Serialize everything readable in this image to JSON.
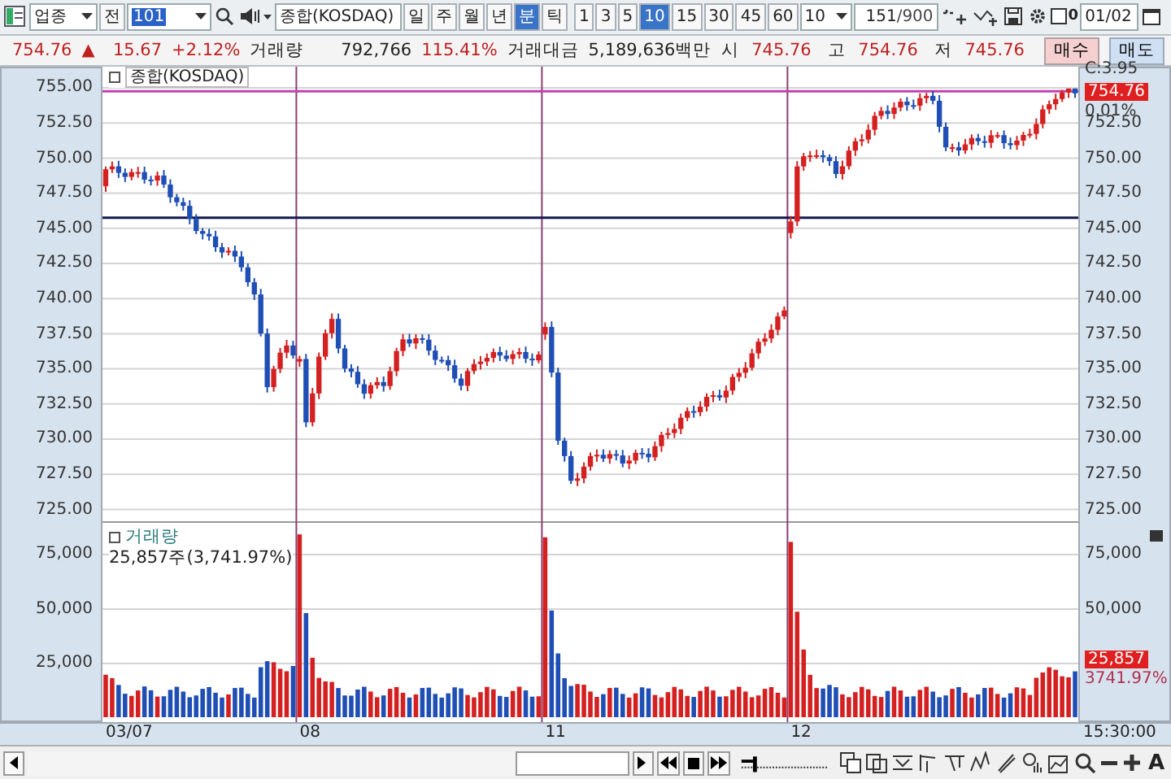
{
  "toolbar": {
    "market_select": "업종",
    "prev_button": "전",
    "code_field": "101",
    "name_field": "종합(KOSDAQ)",
    "periods": [
      {
        "label": "일",
        "selected": false
      },
      {
        "label": "주",
        "selected": false
      },
      {
        "label": "월",
        "selected": false
      },
      {
        "label": "년",
        "selected": false
      },
      {
        "label": "분",
        "selected": true
      },
      {
        "label": "틱",
        "selected": false
      }
    ],
    "intervals": [
      {
        "label": "1",
        "selected": false
      },
      {
        "label": "3",
        "selected": false
      },
      {
        "label": "5",
        "selected": false
      },
      {
        "label": "10",
        "selected": true
      },
      {
        "label": "15",
        "selected": false
      },
      {
        "label": "30",
        "selected": false
      },
      {
        "label": "45",
        "selected": false
      },
      {
        "label": "60",
        "selected": false
      }
    ],
    "count_select": "10",
    "range_field": {
      "value": "151",
      "total": "/900"
    },
    "checkbox": {
      "checked": false,
      "label": "0"
    },
    "date_field": "01/02"
  },
  "quote": {
    "price": "754.76",
    "change_sign": "▲",
    "change": "15.67",
    "change_pct": "+2.12%",
    "volume_label": "거래량",
    "volume": "792,766",
    "volume_pct": "115.41%",
    "value_label": "거래대금",
    "value": "5,189,636백만",
    "open_label": "시",
    "open": "745.76",
    "high_label": "고",
    "high": "754.76",
    "low_label": "저",
    "low": "745.76",
    "buy_button": "매수",
    "sell_button": "매도"
  },
  "price_pane": {
    "legend": "종합(KOSDAQ)",
    "ticks": [
      "755.00",
      "752.50",
      "750.00",
      "747.50",
      "745.00",
      "742.50",
      "740.00",
      "737.50",
      "735.00",
      "732.50",
      "730.00",
      "727.50",
      "725.00"
    ],
    "right_ticks": [
      "752.50",
      "750.00",
      "747.50",
      "745.00",
      "742.50",
      "740.00",
      "737.50",
      "735.00",
      "732.50",
      "730.00",
      "727.50",
      "725.00"
    ],
    "change_label": "C:3.95",
    "current": "754.76",
    "current_pct": "0.01%"
  },
  "volume_pane": {
    "legend": "거래량",
    "value_line": "25,857주(3,741.97%)",
    "ticks": [
      "75,000",
      "50,000",
      "25,000"
    ],
    "right_ticks": [
      "75,000",
      "50,000"
    ],
    "current": "25,857",
    "current_pct": "3741.97%"
  },
  "x_axis": {
    "labels": [
      "03/07",
      "08",
      "11",
      "12"
    ],
    "time": "15:30:00"
  },
  "bottom_tools": {
    "zoom_slider": {
      "level": 0.15
    },
    "font_label": "A"
  }
}
